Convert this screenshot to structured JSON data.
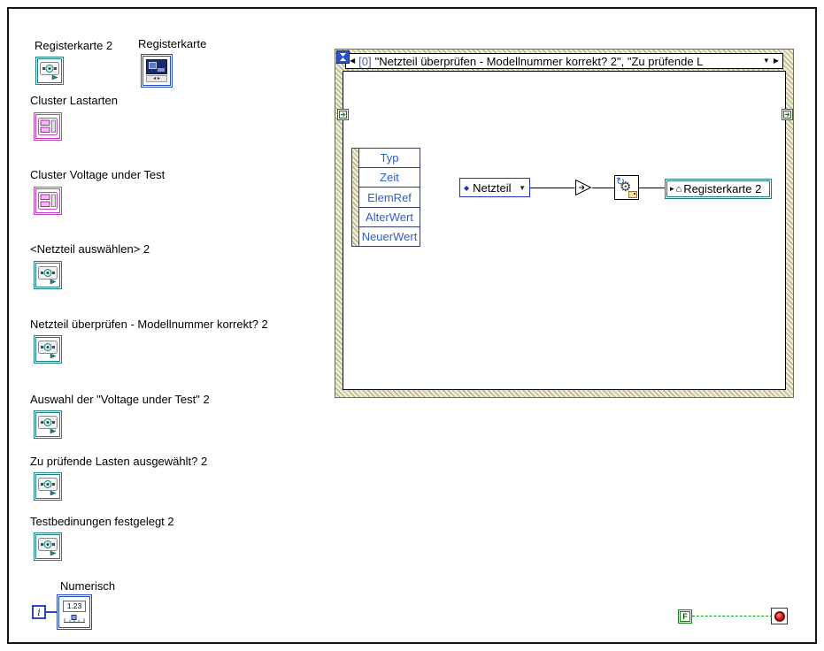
{
  "window": {
    "app": "LabVIEW block diagram",
    "background": "#ffffff"
  },
  "colors": {
    "teal_terminal": "#1e7f7f",
    "cluster_pink": "#c040c0",
    "numeric_blue": "#2747c9",
    "boolean_green": "#1f7a1f",
    "wire_boolean": "#0ba00b",
    "stop_red": "#d01010",
    "event_node_text": "#2e5fc2",
    "structure_hatch_light": "#edead2",
    "structure_hatch_dark": "#a8a584"
  },
  "icons": {
    "prev": "◀",
    "next": "▶",
    "dropdown": "▼",
    "enum_glyph": "◆",
    "local_prefix": "▸",
    "local_house": "⌂"
  },
  "terminals": [
    {
      "label": "Registerkarte 2",
      "type": "tab-control-terminal"
    },
    {
      "label": "Registerkarte",
      "type": "tab-control-constant"
    },
    {
      "label": "Cluster Lastarten",
      "type": "cluster-terminal"
    },
    {
      "label": "Cluster Voltage under Test",
      "type": "cluster-terminal"
    },
    {
      "label": "<Netzteil auswählen> 2",
      "type": "tab-page-terminal"
    },
    {
      "label": "Netzteil überprüfen - Modellnummer korrekt? 2",
      "type": "tab-page-terminal"
    },
    {
      "label": "Auswahl der \"Voltage under Test\" 2",
      "type": "tab-page-terminal"
    },
    {
      "label": "Zu prüfende Lasten ausgewählt? 2",
      "type": "tab-page-terminal"
    },
    {
      "label": "Testbedinungen festgelegt 2",
      "type": "tab-page-terminal"
    },
    {
      "label": "Numerisch",
      "type": "numeric-indicator"
    }
  ],
  "numeric": {
    "value": "1.23",
    "loop_label": "i"
  },
  "event_structure": {
    "selector": {
      "index": "[0]",
      "title": "\"Netzteil überprüfen - Modellnummer korrekt? 2\", \"Zu prüfende L"
    },
    "event_data_node": {
      "fields": [
        "Typ",
        "Zeit",
        "ElemRef",
        "AlterWert",
        "NeuerWert"
      ]
    },
    "enum_constant": {
      "label": "Netzteil"
    },
    "local_variable": {
      "label": "Registerkarte 2"
    },
    "stop": {
      "boolean_constant": "F"
    }
  }
}
